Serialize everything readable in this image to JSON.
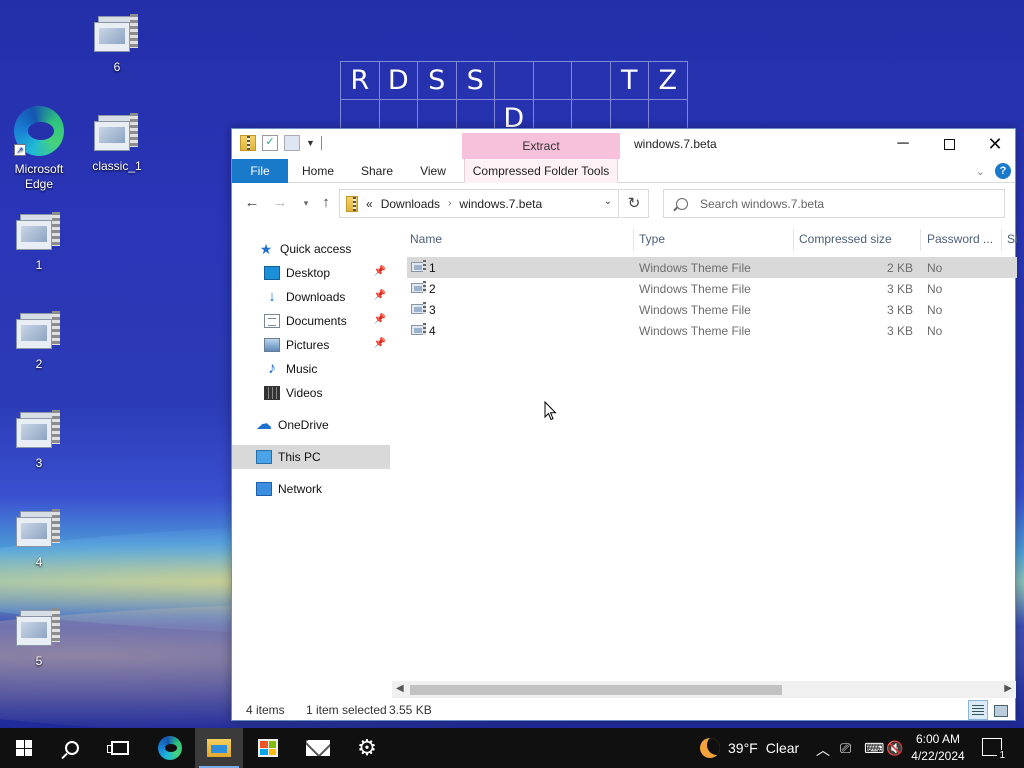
{
  "desktop": {
    "crossword": [
      "R",
      "D",
      "S",
      "S",
      "",
      "",
      "",
      "T",
      "Z",
      "",
      "",
      "",
      "",
      "D",
      "",
      "",
      "",
      ""
    ],
    "icons": [
      {
        "label": "6",
        "type": "theme"
      },
      {
        "label": "Microsoft Edge",
        "type": "edge"
      },
      {
        "label": "classic_1",
        "type": "theme"
      },
      {
        "label": "1",
        "type": "theme"
      },
      {
        "label": "2",
        "type": "theme"
      },
      {
        "label": "3",
        "type": "theme"
      },
      {
        "label": "4",
        "type": "theme"
      },
      {
        "label": "5",
        "type": "theme"
      }
    ]
  },
  "window": {
    "title": "windows.7.beta",
    "context_tab_group": "Extract",
    "ribbon_tabs": [
      "File",
      "Home",
      "Share",
      "View",
      "Compressed Folder Tools"
    ],
    "address": {
      "overflow": "«",
      "crumbs": [
        "Downloads",
        "windows.7.beta"
      ]
    },
    "search_placeholder": "Search windows.7.beta",
    "nav_pane": [
      {
        "label": "Quick access",
        "icon": "star-icon",
        "pinned": false
      },
      {
        "label": "Desktop",
        "icon": "desktop-icon",
        "pinned": true
      },
      {
        "label": "Downloads",
        "icon": "download-icon",
        "pinned": true
      },
      {
        "label": "Documents",
        "icon": "documents-icon",
        "pinned": true
      },
      {
        "label": "Pictures",
        "icon": "pictures-icon",
        "pinned": true
      },
      {
        "label": "Music",
        "icon": "music-icon",
        "pinned": false
      },
      {
        "label": "Videos",
        "icon": "videos-icon",
        "pinned": false
      },
      {
        "label": "OneDrive",
        "icon": "cloud-icon",
        "pinned": false
      },
      {
        "label": "This PC",
        "icon": "pc-icon",
        "pinned": false,
        "selected": true
      },
      {
        "label": "Network",
        "icon": "network-icon",
        "pinned": false
      }
    ],
    "columns": [
      "Name",
      "Type",
      "Compressed size",
      "Password ...",
      "Si"
    ],
    "files": [
      {
        "name": "1",
        "type": "Windows Theme File",
        "size": "2 KB",
        "password": "No",
        "selected": true
      },
      {
        "name": "2",
        "type": "Windows Theme File",
        "size": "3 KB",
        "password": "No"
      },
      {
        "name": "3",
        "type": "Windows Theme File",
        "size": "3 KB",
        "password": "No"
      },
      {
        "name": "4",
        "type": "Windows Theme File",
        "size": "3 KB",
        "password": "No"
      }
    ],
    "status": {
      "items": "4 items",
      "selected": "1 item selected",
      "size": "3.55 KB"
    }
  },
  "taskbar": {
    "weather_temp": "39°F",
    "weather_text": "Clear",
    "time": "6:00 AM",
    "date": "4/22/2024",
    "notification_count": "1"
  }
}
